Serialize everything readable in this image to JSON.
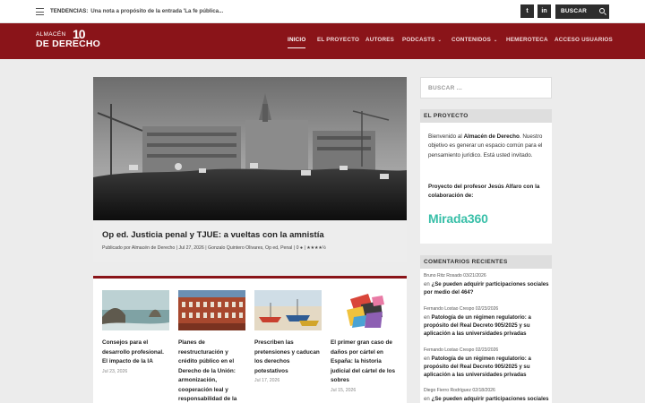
{
  "topbar": {
    "trending_label": "TENDENCIAS:",
    "trending_text": "Una nota a propósito de la entrada 'La fe pública...",
    "twitter": "twitter-icon",
    "linkedin": "linkedin-icon",
    "search_label": "BUSCAR"
  },
  "header": {
    "logo_line1": "ALMACÉN",
    "logo_line2": "DE DERECHO",
    "logo_ten": "10",
    "nav": [
      {
        "label": "INICIO",
        "active": true
      },
      {
        "label": "EL PROYECTO"
      },
      {
        "label": "AUTORES"
      },
      {
        "label": "PODCASTS",
        "dropdown": true
      },
      {
        "label": "CONTENIDOS",
        "dropdown": true
      },
      {
        "label": "HEMEROTECA"
      },
      {
        "label": "ACCESO USUARIOS"
      }
    ]
  },
  "featured": {
    "title": "Op ed. Justicia penal y TJUE: a vueltas con la amnistía",
    "meta": "Publicado por Almacén de Derecho | Jul 27, 2026 | Gonzalo Quintero Olivares, Op ed, Penal | 0",
    "rating": "★★★★½"
  },
  "posts": [
    {
      "title": "Consejos para el desarrollo profesional. El impacto de la IA",
      "date": "Jul 23, 2026"
    },
    {
      "title": "Planes de reestructuración y crédito público en el Derecho de la Unión: armonización, cooperación leal y responsabilidad de la",
      "date": ""
    },
    {
      "title": "Prescriben las pretensiones y caducan los derechos potestativos",
      "date": "Jul 17, 2026"
    },
    {
      "title": "El primer gran caso de daños por cártel en España: la historia judicial del cártel de los sobres",
      "date": "Jul 15, 2026"
    }
  ],
  "sidebar": {
    "search_placeholder": "BUSCAR ...",
    "about": {
      "heading": "EL PROYECTO",
      "text_pre": "Bienvenido al ",
      "text_bold": "Almacén de Derecho",
      "text_post": ". Nuestro objetivo es generar un espacio común para el pensamiento jurídico. Está usted invitado.",
      "credit": "Proyecto del profesor Jesús Alfaro con la colaboración de:",
      "partner_logo": "Mirada360"
    },
    "comments": {
      "heading": "COMENTARIOS RECIENTES",
      "on_word": "en",
      "items": [
        {
          "who": "Bruno Ritz Rosado 03/21/2026",
          "post": "¿Se pueden adquirir participaciones sociales por medio del 464?"
        },
        {
          "who": "Fernando Lostao Crespo 02/23/2026",
          "post": "Patología de un régimen regulatorio: a propósito del Real Decreto 905/2025 y su aplicación a las universidades privadas"
        },
        {
          "who": "Fernando Lostao Crespo 02/23/2026",
          "post": "Patología de un régimen regulatorio: a propósito del Real Decreto 905/2025 y su aplicación a las universidades privadas"
        },
        {
          "who": "Diego Fierro Rodríguez 02/18/2026",
          "post": "¿Se pueden adquirir participaciones sociales"
        }
      ]
    }
  }
}
